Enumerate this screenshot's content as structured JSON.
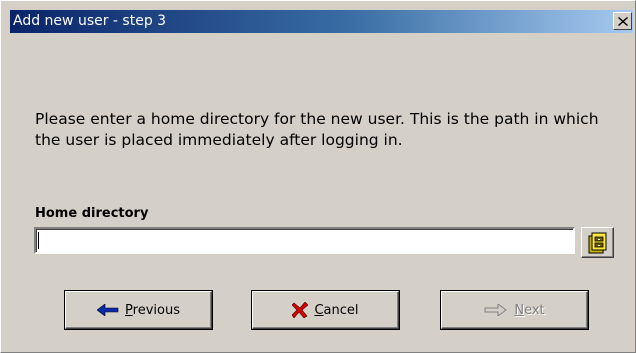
{
  "window": {
    "title": "Add new user - step 3",
    "close_glyph": "✕"
  },
  "description": "Please enter a home directory for the new user. This is the path in which the user is placed immediately after logging in.",
  "home_directory": {
    "label": "Home directory",
    "value": "",
    "browse_icon": "folder-browse-icon"
  },
  "buttons": {
    "previous": {
      "label_first": "P",
      "label_rest": "revious",
      "icon": "left-arrow-icon",
      "enabled": true
    },
    "cancel": {
      "label_first": "C",
      "label_rest": "ancel",
      "icon": "red-x-icon",
      "enabled": true
    },
    "next": {
      "label_first": "N",
      "label_rest": "ext",
      "icon": "right-arrow-icon",
      "enabled": false
    }
  },
  "colors": {
    "dialog_bg": "#d4d0c8",
    "titlebar_start": "#0a246a",
    "titlebar_end": "#a6caf0",
    "arrow_blue": "#0b2aa8",
    "cancel_red": "#d40000",
    "disabled_text": "#808080"
  }
}
